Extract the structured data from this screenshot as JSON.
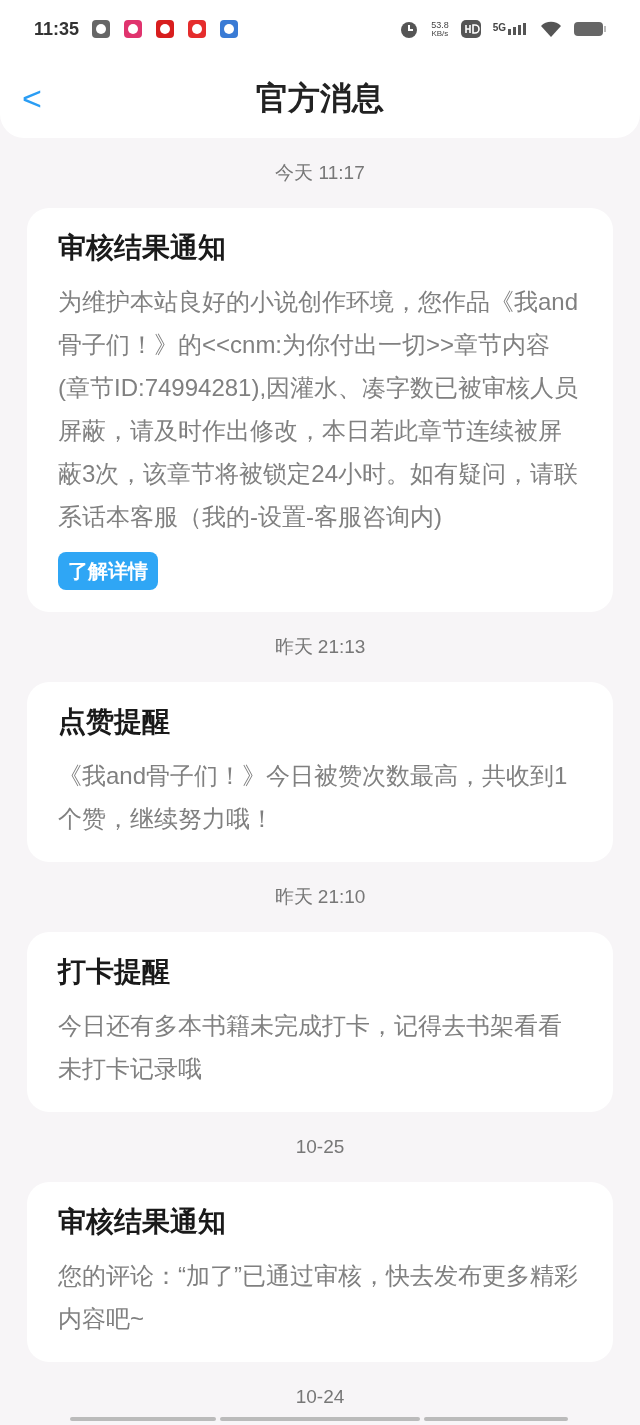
{
  "status_bar": {
    "time": "11:35",
    "net_speed": "53.8",
    "net_unit": "KB/s",
    "network": "5G"
  },
  "header": {
    "back": "<",
    "title": "官方消息"
  },
  "messages": [
    {
      "time": "今天 11:17",
      "title": "审核结果通知",
      "body": "为维护本站良好的小说创作环境，您作品《我and骨子们！》的<<cnm:为你付出一切>>章节内容(章节ID:74994281),因灌水、凑字数已被审核人员屏蔽，请及时作出修改，本日若此章节连续被屏蔽3次，该章节将被锁定24小时。如有疑问，请联系话本客服（我的-设置-客服咨询内)",
      "action": "了解详情"
    },
    {
      "time": "昨天 21:13",
      "title": "点赞提醒",
      "body": "《我and骨子们！》今日被赞次数最高，共收到1个赞，继续努力哦！"
    },
    {
      "time": "昨天 21:10",
      "title": "打卡提醒",
      "body": "今日还有多本书籍未完成打卡，记得去书架看看未打卡记录哦"
    },
    {
      "time": "10-25",
      "title": "审核结果通知",
      "body": "您的评论：“加了”已通过审核，快去发布更多精彩内容吧~"
    }
  ],
  "last_time": "10-24"
}
